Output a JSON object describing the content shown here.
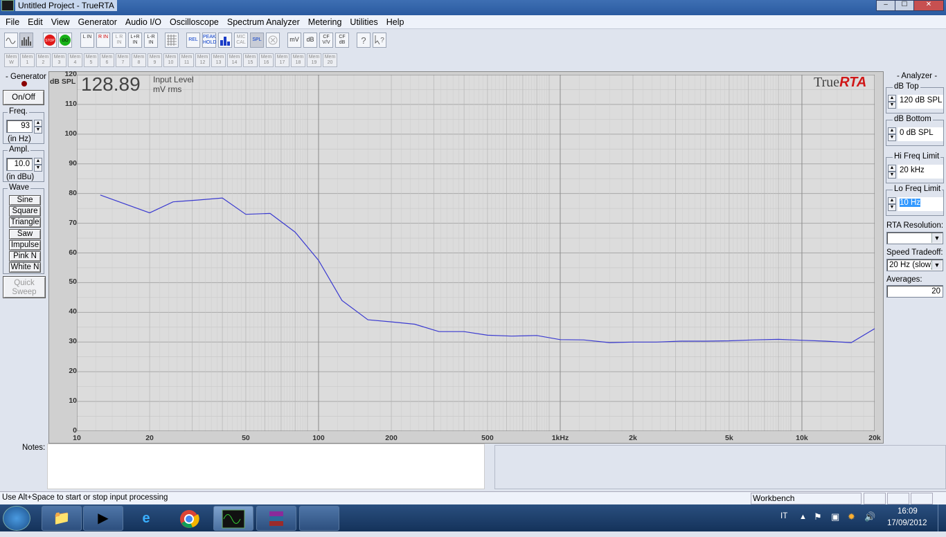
{
  "window": {
    "title": "Untitled Project - TrueRTA"
  },
  "menu": [
    "File",
    "Edit",
    "View",
    "Generator",
    "Audio I/O",
    "Oscilloscope",
    "Spectrum Analyzer",
    "Metering",
    "Utilities",
    "Help"
  ],
  "toolbar": {
    "stop": "STOP",
    "go": "GO",
    "l_in": "L IN",
    "r_in": "R IN",
    "lr_in_dim": "L R IN",
    "lpr_in": "L+R IN",
    "lmr_in": "L-R IN",
    "rel": "REL",
    "peak_hold": "PEAK HOLD",
    "mic_cal": "MIC CAL",
    "spl": "SPL",
    "mv": "mV",
    "db": "dB",
    "cf_vv": "CF V/V",
    "cf_db": "CF dB"
  },
  "memory": {
    "items": [
      "Mem W",
      "Mem 1",
      "Mem 2",
      "Mem 3",
      "Mem 4",
      "Mem 5",
      "Mem 6",
      "Mem 7",
      "Mem 8",
      "Mem 9",
      "Mem 10",
      "Mem 11",
      "Mem 12",
      "Mem 13",
      "Mem 14",
      "Mem 15",
      "Mem 16",
      "Mem 17",
      "Mem 18",
      "Mem 19",
      "Mem 20"
    ]
  },
  "generator": {
    "title": "Generator",
    "on_off": "On/Off",
    "freq_title": "Freq.",
    "freq_value": "93",
    "freq_unit": "(in Hz)",
    "ampl_title": "Ampl.",
    "ampl_value": "10.0",
    "ampl_unit": "(in dBu)",
    "wave_title": "Wave",
    "waves": [
      "Sine",
      "Square",
      "Triangle",
      "Saw",
      "Impulse",
      "Pink N",
      "White N"
    ],
    "quick_sweep": "Quick Sweep"
  },
  "analyzer": {
    "title": "Analyzer",
    "db_top_title": "dB Top",
    "db_top": "120 dB SPL",
    "db_bottom_title": "dB Bottom",
    "db_bottom": "0 dB SPL",
    "hi_freq_title": "Hi Freq Limit",
    "hi_freq": "20 kHz",
    "lo_freq_title": "Lo Freq Limit",
    "lo_freq": "10 Hz",
    "rta_res_title": "RTA Resolution:",
    "rta_res": "",
    "speed_title": "Speed Tradeoff:",
    "speed": "20 Hz (slow)",
    "averages_title": "Averages:",
    "averages": "20"
  },
  "readout": {
    "value": "128.89",
    "line1": "Input Level",
    "line2": "mV rms",
    "unit": "dB SPL"
  },
  "logo": {
    "part1": "True",
    "part2": "RTA"
  },
  "chart_data": {
    "type": "line",
    "xscale": "log",
    "xlim": [
      10,
      20000
    ],
    "ylim": [
      0,
      120
    ],
    "ylabel": "dB SPL",
    "yticks": [
      "120",
      "110",
      "100",
      "90",
      "80",
      "70",
      "60",
      "50",
      "40",
      "30",
      "20",
      "10",
      "0"
    ],
    "xtick_labels": [
      {
        "v": 10,
        "t": "10"
      },
      {
        "v": 20,
        "t": "20"
      },
      {
        "v": 50,
        "t": "50"
      },
      {
        "v": 100,
        "t": "100"
      },
      {
        "v": 200,
        "t": "200"
      },
      {
        "v": 500,
        "t": "500"
      },
      {
        "v": 1000,
        "t": "1kHz"
      },
      {
        "v": 2000,
        "t": "2k"
      },
      {
        "v": 5000,
        "t": "5k"
      },
      {
        "v": 10000,
        "t": "10k"
      },
      {
        "v": 20000,
        "t": "20k"
      }
    ],
    "grid": true,
    "color": "#3a3ad0",
    "x": [
      12.5,
      20,
      25,
      31.5,
      40,
      50,
      63,
      80,
      100,
      125,
      160,
      200,
      250,
      315,
      400,
      500,
      630,
      800,
      1000,
      1250,
      1600,
      2000,
      2500,
      3150,
      4000,
      5000,
      6300,
      8000,
      10000,
      12500,
      16000,
      20000
    ],
    "y": [
      79.5,
      73.5,
      77.2,
      77.8,
      78.5,
      73.0,
      73.3,
      67.0,
      57.5,
      44.0,
      37.5,
      36.8,
      36.0,
      33.5,
      33.5,
      32.3,
      32.0,
      32.2,
      30.8,
      30.7,
      29.8,
      30.0,
      30.0,
      30.3,
      30.3,
      30.4,
      30.7,
      30.9,
      30.6,
      30.3,
      29.8,
      34.5
    ]
  },
  "notes": {
    "label": "Notes:"
  },
  "status": {
    "hint": "Use Alt+Space to start or stop input processing",
    "mode": "Workbench"
  },
  "taskbar": {
    "lang": "IT",
    "time": "16:09",
    "date": "17/09/2012"
  }
}
